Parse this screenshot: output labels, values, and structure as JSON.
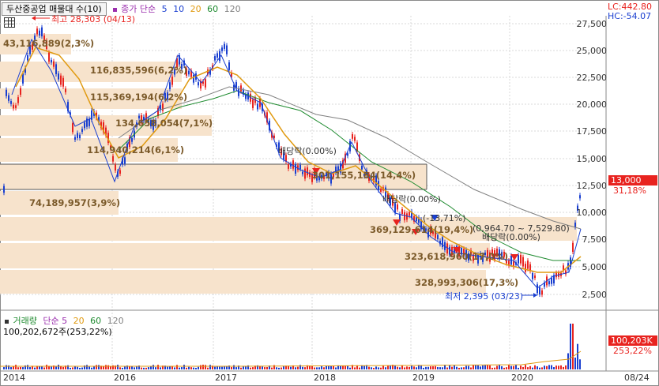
{
  "header": {
    "stock_name": "두산중공업 매물대 수(10)",
    "legend": [
      {
        "label": "종가 단순",
        "color": "#9b2fae"
      },
      {
        "label": "5",
        "color": "#1a3fd0"
      },
      {
        "label": "10",
        "color": "#1a3fd0"
      },
      {
        "label": "20",
        "color": "#e09a10"
      },
      {
        "label": "60",
        "color": "#1d8a2e"
      },
      {
        "label": "120",
        "color": "#808080"
      }
    ]
  },
  "indicators": {
    "lc": "LC:442.80",
    "hc": "HC:-54.07"
  },
  "annotations": {
    "high": "최고 28,303 (04/13)",
    "low": "최저 2,395 (03/23)",
    "ex_div1": "배당락(0.00%)",
    "ex_div2": "배당락(0.00%)",
    "ex_div3": "배당락(0.00%)",
    "ex_change": "(-13,71%)",
    "range_label": "(0,964.70 ~ 7,529.80)"
  },
  "volume_profile": [
    {
      "label": "43,116,889(2,3%)"
    },
    {
      "label": "116,835,596(6,2%)"
    },
    {
      "label": "115,369,194(6,2%)"
    },
    {
      "label": "134,658,054(7,1%)"
    },
    {
      "label": "114,940,214(6,1%)"
    },
    {
      "label": "301,155,184(14,4%)"
    },
    {
      "label": "74,189,957(3,9%)"
    },
    {
      "label": "369,129,614(19,4%)"
    },
    {
      "label": "323,618,960(17,0%)"
    },
    {
      "label": "328,993,306(17,3%)"
    }
  ],
  "price_axis": [
    "27,500",
    "25,000",
    "22,500",
    "20,000",
    "17,500",
    "15,000",
    "12,500",
    "10,000",
    "7,500",
    "5,000",
    "2,500"
  ],
  "price_tag": {
    "value": "13,000",
    "pct": "31,18%"
  },
  "volume_panel": {
    "legend_title": "거래량",
    "legend_items": [
      {
        "label": "단순 5",
        "color": "#9b2fae"
      },
      {
        "label": "20",
        "color": "#e09a10"
      },
      {
        "label": "60",
        "color": "#1d8a2e"
      },
      {
        "label": "120",
        "color": "#808080"
      }
    ],
    "current": "100,202,672주(253,22%)",
    "tag_value": "100,203K",
    "tag_pct": "253,22%"
  },
  "x_axis": [
    "2014",
    "2016",
    "2017",
    "2018",
    "2019",
    "2020",
    "08/24"
  ],
  "colors": {
    "up": "#e8231f",
    "down": "#1a3fd0",
    "box": "#f7e3cc",
    "ma5": "#1a3fd0",
    "ma20": "#e09a10",
    "ma60": "#1d8a2e",
    "ma120": "#808080"
  }
}
